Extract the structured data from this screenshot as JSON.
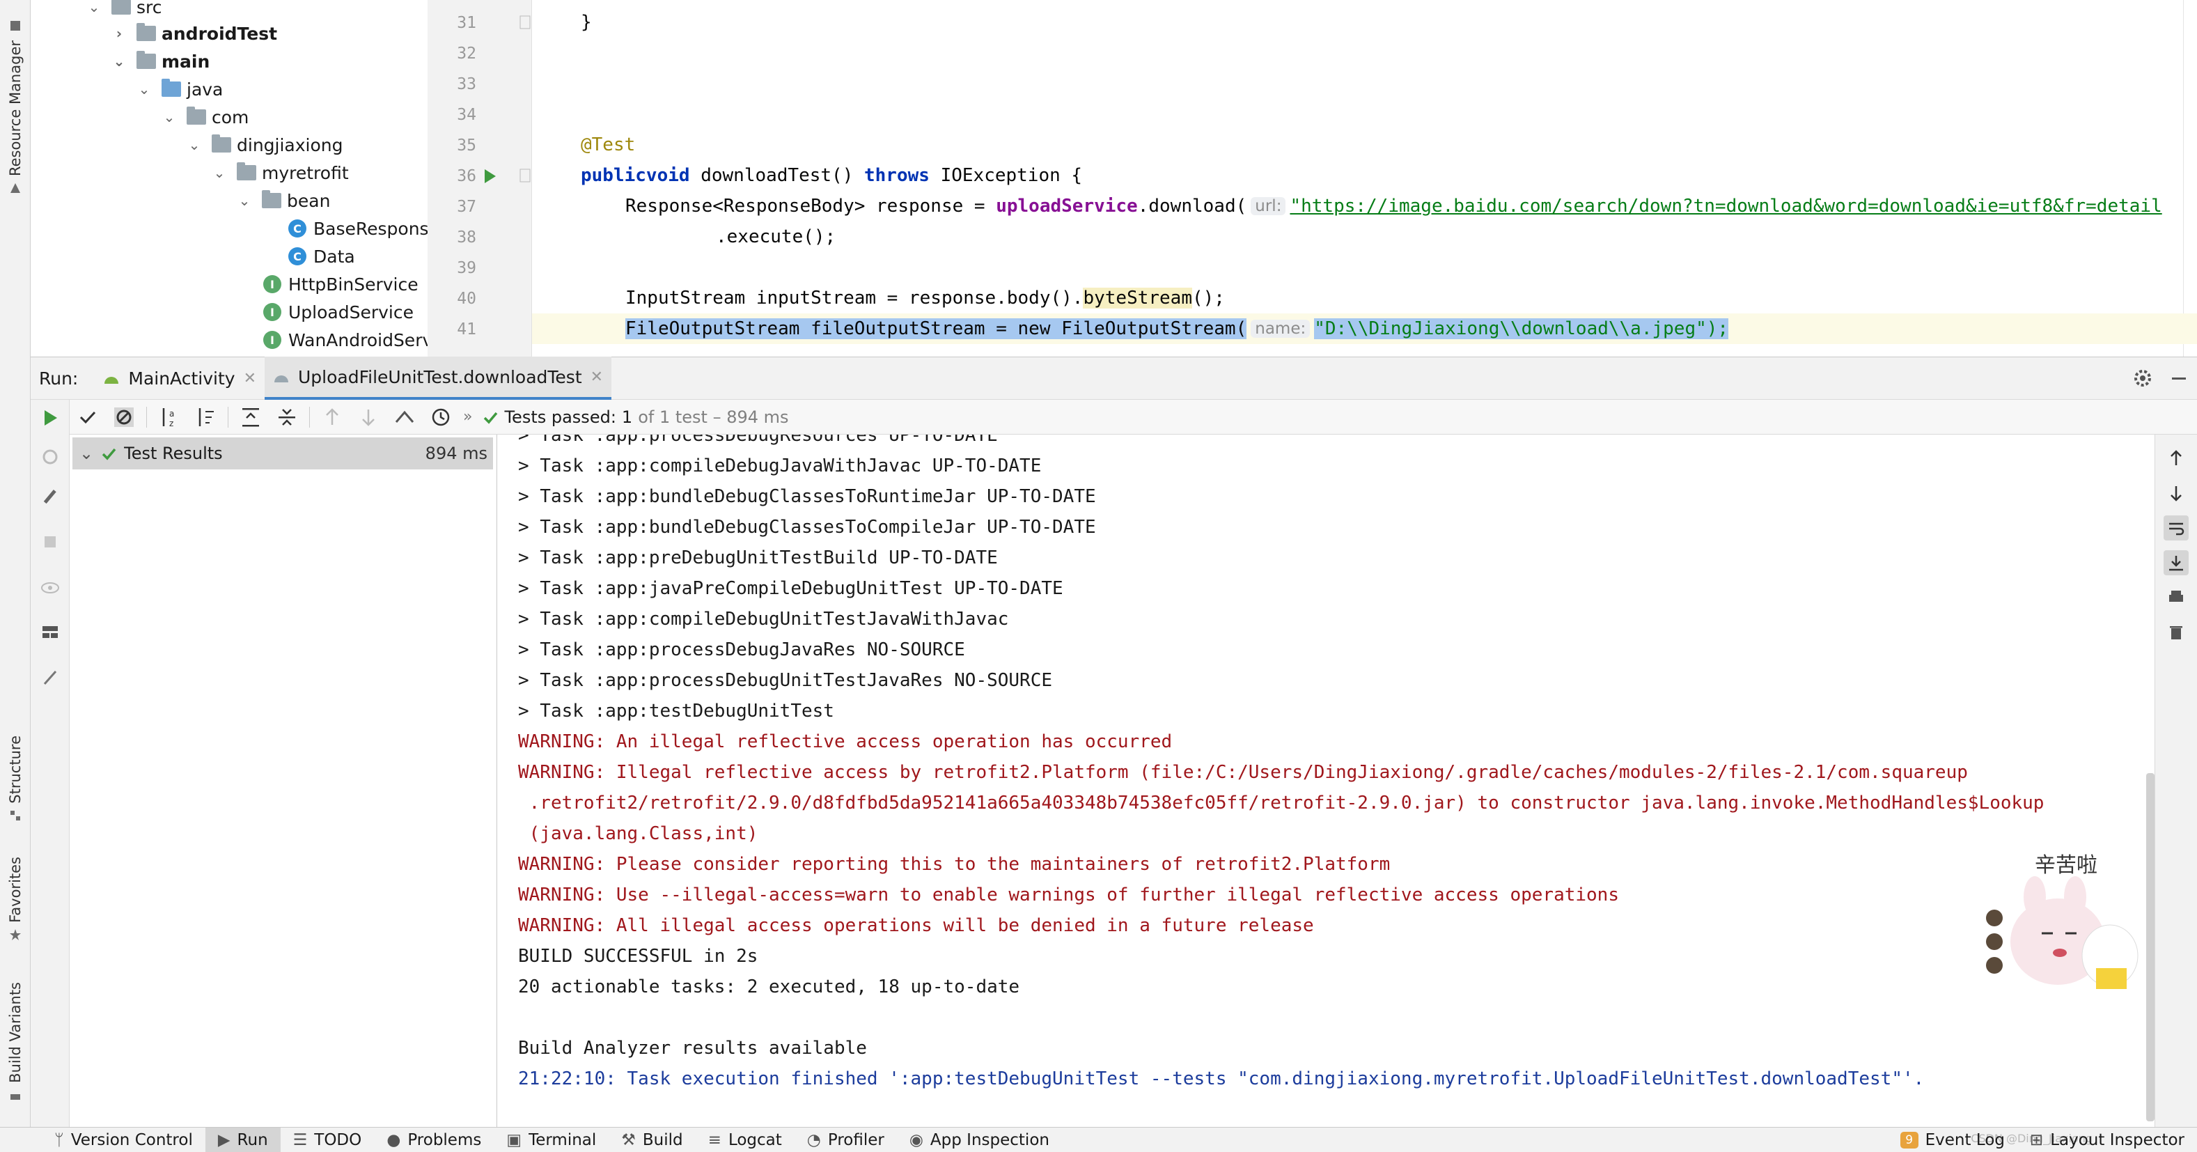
{
  "left_stripe": {
    "tabs": [
      {
        "label": "Resource Manager",
        "icon": "resource-manager-icon"
      },
      {
        "label": "Structure",
        "icon": "structure-icon"
      },
      {
        "label": "Favorites",
        "icon": "star-icon"
      },
      {
        "label": "Build Variants",
        "icon": "build-variants-icon"
      }
    ]
  },
  "project_tree": {
    "items": [
      {
        "label": "src",
        "type": "folder"
      },
      {
        "label": "androidTest",
        "type": "folder"
      },
      {
        "label": "main",
        "type": "folder"
      },
      {
        "label": "java",
        "type": "source-folder"
      },
      {
        "label": "com",
        "type": "package"
      },
      {
        "label": "dingjiaxiong",
        "type": "package"
      },
      {
        "label": "myretrofit",
        "type": "package"
      },
      {
        "label": "bean",
        "type": "package"
      },
      {
        "label": "BaseResponse",
        "type": "class",
        "glyph": "C"
      },
      {
        "label": "Data",
        "type": "class",
        "glyph": "C"
      },
      {
        "label": "HttpBinService",
        "type": "interface",
        "glyph": "I"
      },
      {
        "label": "UploadService",
        "type": "interface",
        "glyph": "I"
      },
      {
        "label": "WanAndroidServ",
        "type": "interface",
        "glyph": "I"
      }
    ]
  },
  "editor": {
    "line_numbers": [
      "31",
      "32",
      "33",
      "34",
      "35",
      "36",
      "37",
      "38",
      "39",
      "40",
      "41"
    ],
    "line31": "}",
    "line35_annotation": "@Test",
    "line36": {
      "kw1": "public",
      "kw2": "void",
      "name": " downloadTest() ",
      "kw3": "throws",
      "rest": " IOException {"
    },
    "line37": {
      "prefix": "Response<ResponseBody> response = ",
      "field": "uploadService",
      "call": ".download(",
      "hint": "url:",
      "url": "\"https://image.baidu.com/search/down?tn=download&word=download&ie=utf8&fr=detail"
    },
    "line38": ".execute();",
    "line40": {
      "prefix": "InputStream inputStream = response.body().",
      "highlight": "byteStream",
      "suffix": "();"
    },
    "line41": {
      "code": "FileOutputStream fileOutputStream = new FileOutputStream(",
      "hint": "name:",
      "str": "\"D:\\\\DingJiaxiong\\\\download\\\\a.jpeg\");"
    }
  },
  "run_window": {
    "label": "Run:",
    "tabs": [
      {
        "label": "MainActivity",
        "icon": "android-icon"
      },
      {
        "label": "UploadFileUnitTest.downloadTest",
        "icon": "test-icon"
      }
    ]
  },
  "toolbar": {
    "status_prefix": "Tests passed:",
    "passed": "1",
    "status_suffix": "of 1 test – 894 ms"
  },
  "test_tree": {
    "root_label": "Test Results",
    "root_duration": "894 ms"
  },
  "console": {
    "lines": [
      {
        "text": "> Task :app:processDebugResources UP-TO-DATE",
        "kind": "normal"
      },
      {
        "text": "> Task :app:compileDebugJavaWithJavac UP-TO-DATE",
        "kind": "normal"
      },
      {
        "text": "> Task :app:bundleDebugClassesToRuntimeJar UP-TO-DATE",
        "kind": "normal"
      },
      {
        "text": "> Task :app:bundleDebugClassesToCompileJar UP-TO-DATE",
        "kind": "normal"
      },
      {
        "text": "> Task :app:preDebugUnitTestBuild UP-TO-DATE",
        "kind": "normal"
      },
      {
        "text": "> Task :app:javaPreCompileDebugUnitTest UP-TO-DATE",
        "kind": "normal"
      },
      {
        "text": "> Task :app:compileDebugUnitTestJavaWithJavac",
        "kind": "normal"
      },
      {
        "text": "> Task :app:processDebugJavaRes NO-SOURCE",
        "kind": "normal"
      },
      {
        "text": "> Task :app:processDebugUnitTestJavaRes NO-SOURCE",
        "kind": "normal"
      },
      {
        "text": "> Task :app:testDebugUnitTest",
        "kind": "normal"
      },
      {
        "text": "WARNING: An illegal reflective access operation has occurred",
        "kind": "warn"
      },
      {
        "text": "WARNING: Illegal reflective access by retrofit2.Platform (file:/C:/Users/DingJiaxiong/.gradle/caches/modules-2/files-2.1/com.squareup",
        "kind": "warn"
      },
      {
        "text": " .retrofit2/retrofit/2.9.0/d8fdfbd5da952141a665a403348b74538efc05ff/retrofit-2.9.0.jar) to constructor java.lang.invoke.MethodHandles$Lookup",
        "kind": "warn"
      },
      {
        "text": " (java.lang.Class,int)",
        "kind": "warn"
      },
      {
        "text": "WARNING: Please consider reporting this to the maintainers of retrofit2.Platform",
        "kind": "warn"
      },
      {
        "text": "WARNING: Use --illegal-access=warn to enable warnings of further illegal reflective access operations",
        "kind": "warn"
      },
      {
        "text": "WARNING: All illegal access operations will be denied in a future release",
        "kind": "warn"
      },
      {
        "text": "BUILD SUCCESSFUL in 2s",
        "kind": "normal"
      },
      {
        "text": "20 actionable tasks: 2 executed, 18 up-to-date",
        "kind": "normal"
      },
      {
        "text": "",
        "kind": "normal"
      },
      {
        "text": "Build Analyzer results available",
        "kind": "normal"
      },
      {
        "text": "21:22:10: Task execution finished ':app:testDebugUnitTest --tests \"com.dingjiaxiong.myretrofit.UploadFileUnitTest.downloadTest\"'.",
        "kind": "info"
      }
    ]
  },
  "sticker": {
    "caption": "辛苦啦"
  },
  "bottom_bar": {
    "tabs": [
      {
        "label": "Version Control",
        "icon": "branch-icon"
      },
      {
        "label": "Run",
        "icon": "run-icon"
      },
      {
        "label": "TODO",
        "icon": "list-icon"
      },
      {
        "label": "Problems",
        "icon": "problems-icon"
      },
      {
        "label": "Terminal",
        "icon": "terminal-icon"
      },
      {
        "label": "Build",
        "icon": "hammer-icon"
      },
      {
        "label": "Logcat",
        "icon": "logcat-icon"
      },
      {
        "label": "Profiler",
        "icon": "profiler-icon"
      },
      {
        "label": "App Inspection",
        "icon": "inspection-icon"
      }
    ],
    "event_log_count": "9",
    "event_log_label": "Event Log",
    "layout_inspector_label": "Layout Inspector",
    "watermark": "CSDN @Ding_Jiaxiong"
  },
  "colors": {
    "accent": "#4083c9",
    "warning_text": "#a0171c",
    "info_text": "#1c3c9c",
    "passed_green": "#3f9a3f"
  }
}
